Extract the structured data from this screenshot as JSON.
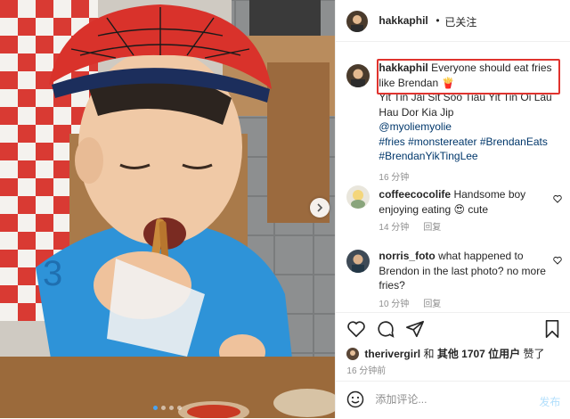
{
  "header": {
    "username": "hakkaphil",
    "separator": "•",
    "follow_status": "已关注"
  },
  "caption": {
    "username": "hakkaphil",
    "text": "Everyone should eat fries like Brendan",
    "emoji": "🍟",
    "body": "Yit Tin Jai Sit Soo Tiau Yit Tin Oi Lau Hau Dor Kia Jip",
    "mention": "@myoliemyolie",
    "hashtags": [
      "#fries",
      "#monstereater",
      "#BrendanEats",
      "#BrendanYikTingLee"
    ],
    "time": "16 分钟"
  },
  "comments": [
    {
      "username": "coffeecocolife",
      "text": "Handsome boy enjoying eating 😍  cute",
      "time": "14 分钟",
      "reply_label": "回复"
    },
    {
      "username": "norris_foto",
      "text": "what happened to Brendon in the last photo? no more fries?",
      "time": "10 分钟",
      "reply_label": "回复"
    }
  ],
  "likes": {
    "liker": "therivergirl",
    "connector": "和",
    "others": "其他 1707 位用户",
    "suffix": "赞了"
  },
  "post_time": "16 分钟前",
  "add_comment": {
    "placeholder": "添加评论...",
    "post_label": "发布"
  },
  "carousel": {
    "slide_count": 4,
    "active_index": 0
  },
  "colors": {
    "highlight_box": "#e0332e",
    "hashtag_link": "#00376b",
    "post_button_disabled": "#b2dffc",
    "active_dot": "#4aa3f0"
  },
  "icons": [
    "chevron-right-icon",
    "heart-icon",
    "comment-icon",
    "share-icon",
    "bookmark-icon",
    "emoji-icon"
  ]
}
